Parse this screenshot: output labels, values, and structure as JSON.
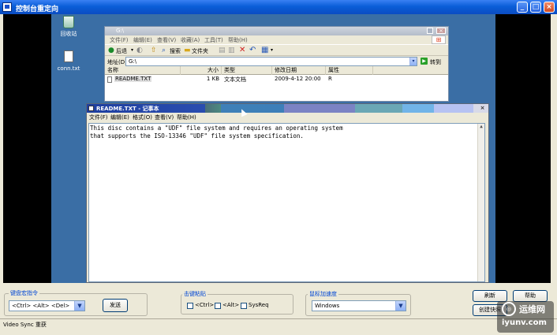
{
  "window": {
    "title": "控制台重定向",
    "minimize_glyph": "_",
    "maximize_glyph": "□",
    "close_glyph": "×"
  },
  "desktop": {
    "icons": [
      {
        "label": "回收站",
        "icon": "recycle-bin-icon"
      },
      {
        "label": "conn.txt",
        "icon": "text-file-icon"
      }
    ]
  },
  "explorer": {
    "title": "G:\\",
    "menu": [
      "文件(F)",
      "编辑(E)",
      "查看(V)",
      "收藏(A)",
      "工具(T)",
      "帮助(H)"
    ],
    "toolbar": {
      "back": "后退",
      "search": "搜索",
      "folders": "文件夹"
    },
    "address_label": "地址(D)",
    "address_value": "G:\\",
    "go": "转到",
    "columns": [
      "名称",
      "大小",
      "类型",
      "修改日期",
      "属性"
    ],
    "files": [
      {
        "name": "README.TXT",
        "size": "1 KB",
        "type": "文本文档",
        "modified": "2009-4-12 20:00",
        "attr": "R"
      }
    ]
  },
  "notepad": {
    "title": "README.TXT - 记事本",
    "menu": [
      "文件(F)",
      "编辑(E)",
      "格式(O)",
      "查看(V)",
      "帮助(H)"
    ],
    "lines": [
      "This disc contains a \"UDF\" file system and requires an operating system",
      "that supports the ISO-13346 \"UDF\" file system specification."
    ]
  },
  "controls": {
    "keyboard_group": "键盘宏指令",
    "macro_value": "<Ctrl> <Alt> <Del>",
    "send": "发送",
    "hotkeys_group": "击键粘贴",
    "keys": [
      "<Ctrl>",
      "<Alt>",
      "SysReq"
    ],
    "mouse_group": "鼠标加速度",
    "mouse_value": "Windows",
    "refresh": "刷新",
    "help": "帮助",
    "snapshot": "创建快照"
  },
  "status": {
    "text": "Video Sync 重获"
  },
  "watermark": {
    "line1": "运维网",
    "line2": "iyunv.com"
  }
}
